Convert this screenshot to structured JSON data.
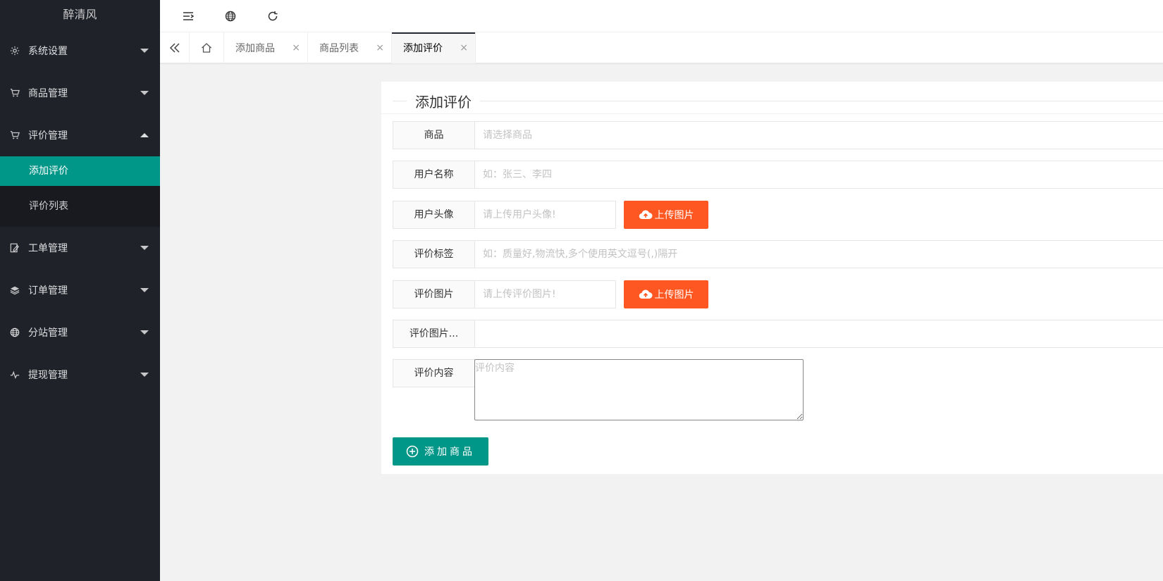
{
  "app": {
    "title": "醉清风"
  },
  "sidebar": {
    "items": [
      {
        "label": "系统设置",
        "icon": "gear-icon"
      },
      {
        "label": "商品管理",
        "icon": "cart-icon"
      },
      {
        "label": "评价管理",
        "icon": "cart-icon",
        "expanded": true,
        "children": [
          {
            "label": "添加评价",
            "active": true
          },
          {
            "label": "评价列表"
          }
        ]
      },
      {
        "label": "工单管理",
        "icon": "edit-icon"
      },
      {
        "label": "订单管理",
        "icon": "layers-icon"
      },
      {
        "label": "分站管理",
        "icon": "globe-icon"
      },
      {
        "label": "提现管理",
        "icon": "pulse-icon"
      }
    ]
  },
  "header": {
    "icons": [
      "menu-fold-icon",
      "globe-icon",
      "refresh-icon"
    ]
  },
  "tabs": {
    "controls": [
      "double-left-icon",
      "home-icon"
    ],
    "items": [
      {
        "label": "添加商品",
        "close": "×"
      },
      {
        "label": "商品列表",
        "close": "×"
      },
      {
        "label": "添加评价",
        "close": "×",
        "active": true
      }
    ]
  },
  "form": {
    "title": "添加评价",
    "fields": {
      "product": {
        "label": "商品",
        "placeholder": "请选择商品",
        "value": ""
      },
      "username": {
        "label": "用户名称",
        "placeholder": "如：张三、李四",
        "value": ""
      },
      "avatar": {
        "label": "用户头像",
        "placeholder": "请上传用户头像!",
        "value": "",
        "button": "上传图片"
      },
      "tags": {
        "label": "评价标签",
        "placeholder": "如：质量好,物流快,多个使用英文逗号(,)隔开",
        "value": ""
      },
      "images": {
        "label": "评价图片",
        "placeholder": "请上传评价图片!",
        "value": "",
        "button": "上传图片"
      },
      "images_extra": {
        "label": "评价图片...",
        "value": ""
      },
      "content": {
        "label": "评价内容",
        "placeholder": "评价内容",
        "value": ""
      }
    },
    "submit_label": "添加商品"
  },
  "colors": {
    "sidebar_bg": "#20222a",
    "accent": "#009688",
    "upload": "#ff5722"
  }
}
